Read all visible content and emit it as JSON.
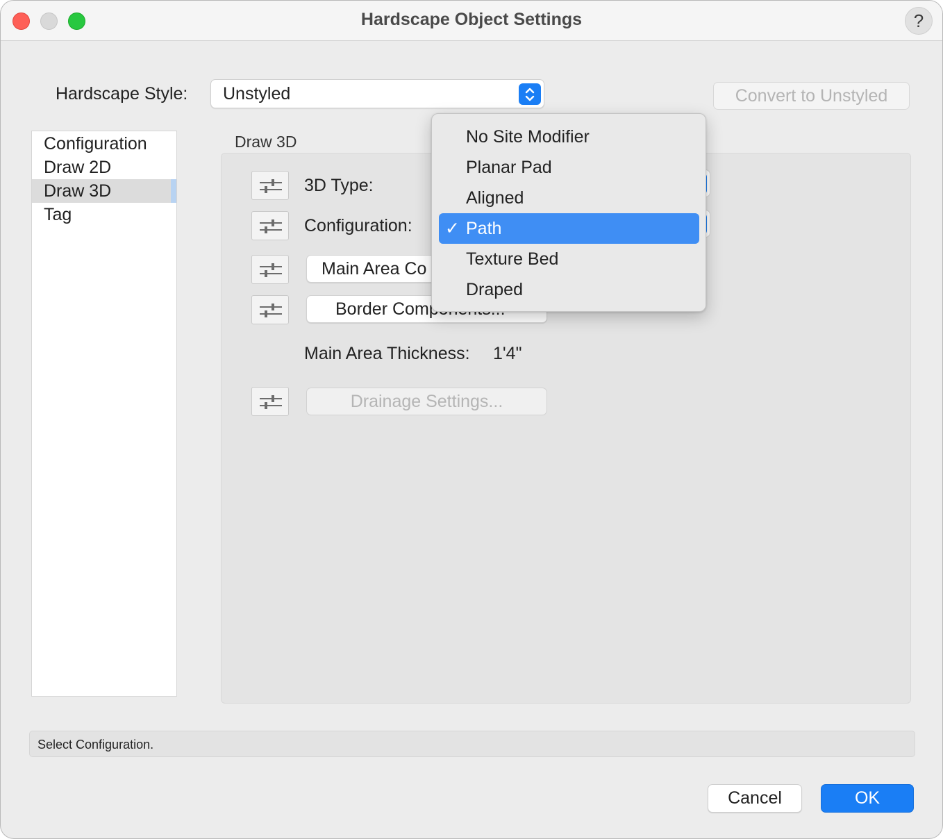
{
  "window": {
    "title": "Hardscape Object Settings",
    "help_label": "?"
  },
  "style_row": {
    "label": "Hardscape Style:",
    "value": "Unstyled",
    "convert_button": "Convert to Unstyled"
  },
  "sidebar": {
    "items": [
      {
        "label": "Configuration",
        "selected": false
      },
      {
        "label": "Draw 2D",
        "selected": false
      },
      {
        "label": "Draw 3D",
        "selected": true
      },
      {
        "label": "Tag",
        "selected": false
      }
    ]
  },
  "panel": {
    "group_title": "Draw 3D",
    "type_label": "3D Type:",
    "configuration_label": "Configuration:",
    "main_area_button": "Main Area Co",
    "border_button": "Border Components...",
    "thickness_label": "Main Area Thickness:",
    "thickness_value": "1'4\"",
    "drainage_button": "Drainage Settings..."
  },
  "dropdown": {
    "options": [
      "No Site Modifier",
      "Planar Pad",
      "Aligned",
      "Path",
      "Texture Bed",
      "Draped"
    ],
    "selected": "Path",
    "check_glyph": "✓"
  },
  "status": {
    "text": "Select Configuration."
  },
  "footer": {
    "cancel_label": "Cancel",
    "ok_label": "OK"
  },
  "colors": {
    "accent": "#1a7ef5",
    "menu_highlight": "#3f8ef4",
    "close": "#fe5f57",
    "zoom": "#28c840"
  }
}
